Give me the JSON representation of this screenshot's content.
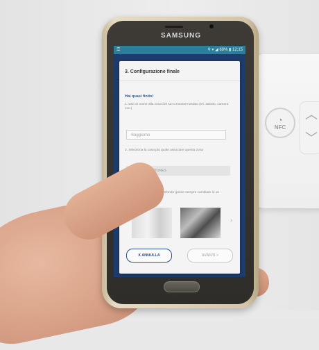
{
  "phone": {
    "brand": "SAMSUNG"
  },
  "status_bar": {
    "left": "☰",
    "right": "⚲ ▾ ◢ 69% ▮ 12:15"
  },
  "dialog": {
    "title": "3. Configurazione finale",
    "subtitle": "Hai quasi finito!",
    "step1": {
      "text": "1. Dai un nome alla zona del tuo Cronotermostato (es. salotto, camera ecc.)",
      "placeholder": "Soggiorno"
    },
    "step2": {
      "text": "2. Seleziona la casa più quale associare questa zona",
      "option": "TEST CRETONES"
    },
    "step3": {
      "text": "3. Associa un'immagine di sfondo (prese sempre cambiare in un secondo tempo)"
    },
    "buttons": {
      "cancel": "X ANNULLA",
      "next": "AVANTI >"
    }
  },
  "device": {
    "nfc_label": "NFC"
  }
}
